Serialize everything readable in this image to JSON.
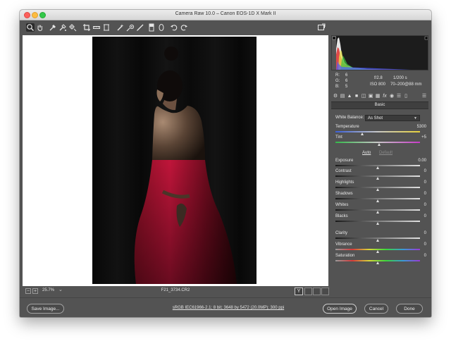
{
  "window": {
    "title": "Camera Raw 10.0  –  Canon EOS-1D X Mark II"
  },
  "toolbar": {
    "tools": [
      "zoom-tool-icon",
      "hand-tool-icon",
      "white-balance-tool-icon",
      "color-sampler-tool-icon",
      "targeted-adjustment-tool-icon",
      "crop-tool-icon",
      "straighten-tool-icon",
      "transform-tool-icon",
      "spot-removal-tool-icon",
      "red-eye-removal-tool-icon",
      "adjustment-brush-icon",
      "graduated-filter-icon",
      "radial-filter-icon",
      "rotate-ccw-icon",
      "rotate-cw-icon"
    ],
    "toggle_fullscreen": "fullscreen-icon"
  },
  "status": {
    "zoom": "25.7%",
    "zoom_arrow": "⌄",
    "minus": "−",
    "plus": "+",
    "filename": "F21_3734.CR2",
    "y_label": "Y"
  },
  "rgb": {
    "r_label": "R:",
    "g_label": "G:",
    "b_label": "B:",
    "r": "6",
    "g": "6",
    "b": "5"
  },
  "exif": {
    "aperture": "f/2.8",
    "shutter": "1/200 s",
    "iso": "ISO 800",
    "lens": "70–200@88 mm"
  },
  "panel": {
    "title": "Basic",
    "white_balance_label": "White Balance:",
    "white_balance_value": "As Shot",
    "auto": "Auto",
    "default": "Default",
    "sliders": [
      {
        "label": "Temperature",
        "value": "5300",
        "level": 0.32,
        "track": "temp"
      },
      {
        "label": "Tint",
        "value": "+5",
        "level": 0.52,
        "track": "tint"
      },
      {
        "label": "Exposure",
        "value": "0.00",
        "level": 0.5,
        "track": "gray"
      },
      {
        "label": "Contrast",
        "value": "0",
        "level": 0.5,
        "track": "gray"
      },
      {
        "label": "Highlights",
        "value": "0",
        "level": 0.5,
        "track": "gray"
      },
      {
        "label": "Shadows",
        "value": "0",
        "level": 0.5,
        "track": "gray"
      },
      {
        "label": "Whites",
        "value": "0",
        "level": 0.5,
        "track": "gray"
      },
      {
        "label": "Blacks",
        "value": "0",
        "level": 0.5,
        "track": "gray"
      },
      {
        "label": "Clarity",
        "value": "0",
        "level": 0.5,
        "track": "gray"
      },
      {
        "label": "Vibrance",
        "value": "0",
        "level": 0.5,
        "track": "sat"
      },
      {
        "label": "Saturation",
        "value": "0",
        "level": 0.5,
        "track": "sat"
      }
    ]
  },
  "buttons": {
    "save_image": "Save Image...",
    "workflow": "sRGB IEC61966-2.1; 8 bit; 3648 by 5472 (20.0MP); 300 ppi",
    "open_image": "Open Image",
    "cancel": "Cancel",
    "done": "Done"
  }
}
